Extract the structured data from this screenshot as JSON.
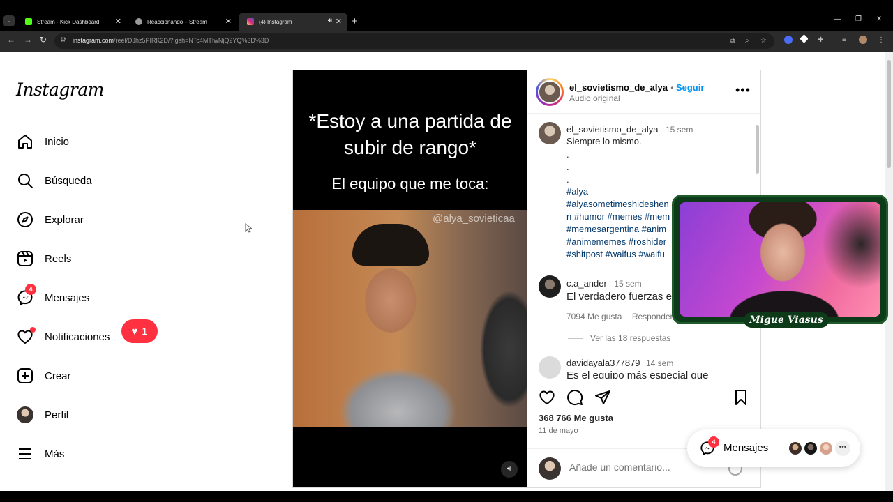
{
  "browser": {
    "tabs": [
      {
        "title": "Stream - Kick Dashboard",
        "favicon_color": "#53fc18"
      },
      {
        "title": "Reaccionando – Stream",
        "favicon_color": "#9a9a9a"
      },
      {
        "title": "(4) Instagram",
        "favicon_color": "#d62976"
      }
    ],
    "url_host": "instagram.com",
    "url_path": "/reel/DJhz5PIRK2D/?igsh=NTc4MTIwNjQ2YQ%3D%3D"
  },
  "sidebar": {
    "logo": "Instagram",
    "items": [
      {
        "label": "Inicio",
        "icon": "home-icon"
      },
      {
        "label": "Búsqueda",
        "icon": "search-icon"
      },
      {
        "label": "Explorar",
        "icon": "compass-icon"
      },
      {
        "label": "Reels",
        "icon": "reels-icon"
      },
      {
        "label": "Mensajes",
        "icon": "messenger-icon",
        "badge": "4"
      },
      {
        "label": "Notificaciones",
        "icon": "heart-icon"
      },
      {
        "label": "Crear",
        "icon": "plus-square-icon"
      },
      {
        "label": "Perfil",
        "icon": "profile-avatar"
      },
      {
        "label": "Más",
        "icon": "menu-icon"
      }
    ],
    "notification_bubble": "1"
  },
  "video": {
    "caption_top": "*Estoy a una partida de subir de rango*",
    "caption_sub": "El equipo que me toca:",
    "watermark": "@alya_sovieticaa"
  },
  "post": {
    "author": "el_sovietismo_de_alya",
    "follow": "Seguir",
    "audio": "Audio original",
    "caption_author": "el_sovietismo_de_alya",
    "caption_time": "15 sem",
    "caption_text": "Siempre lo mismo.",
    "hashtags": [
      "#alya",
      "#alyasometimeshideshen",
      "n #humor #memes #mem",
      "#memesargentina #anim",
      "#animememes #roshider",
      "#shitpost #waifus #waifu"
    ],
    "comments": [
      {
        "user": "c.a_ander",
        "time": "15 sem",
        "text": "El verdadero fuerzas e",
        "likes": "7094 Me gusta",
        "reply": "Responder",
        "replies": "Ver las 18 respuestas"
      },
      {
        "user": "davidayala377879",
        "time": "14 sem",
        "text": "Es el equipo más especial que"
      }
    ],
    "likes": "368 766 Me gusta",
    "date": "11 de mayo",
    "comment_placeholder": "Añade un comentario..."
  },
  "overlay": {
    "streamer_name": "Migue Viasus"
  },
  "messages_pill": {
    "label": "Mensajes",
    "badge": "4"
  }
}
